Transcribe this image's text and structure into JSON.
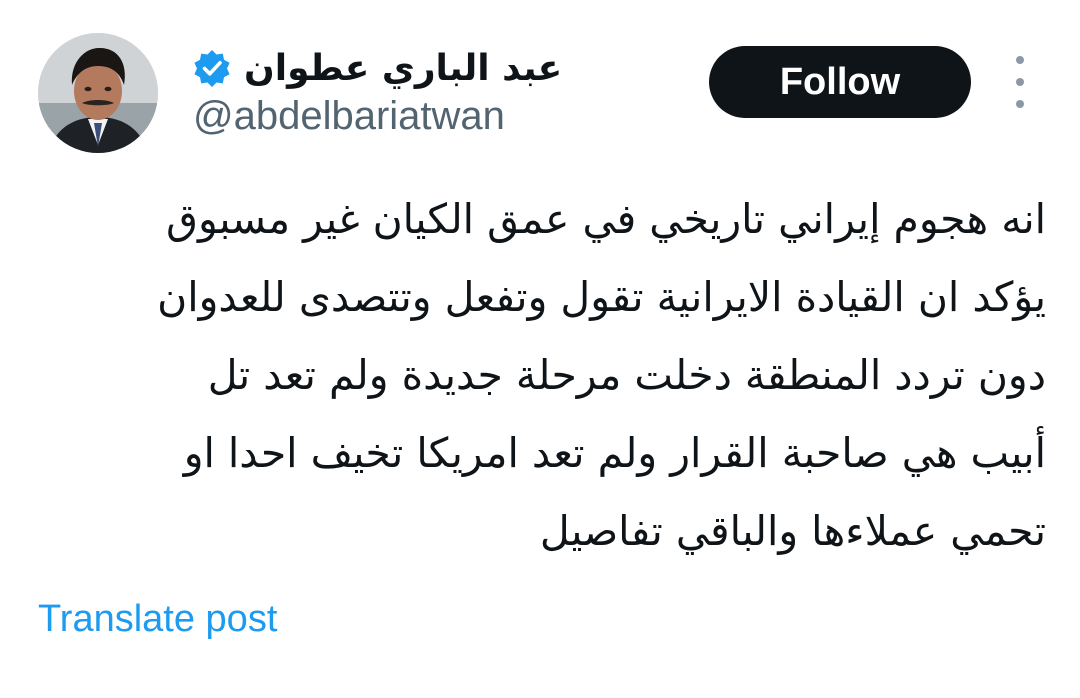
{
  "author": {
    "display_name": "عبد الباري عطوان",
    "handle": "@abdelbariatwan",
    "verified": true,
    "avatar_icon": "person-portrait",
    "verified_icon": "verified-badge-icon"
  },
  "actions": {
    "follow_label": "Follow",
    "more_icon": "more-vertical-icon"
  },
  "post": {
    "lines": [
      "انه هجوم إيراني تاريخي في عمق الكيان غير مسبوق",
      "يؤكد ان القيادة الايرانية تقول وتفعل وتتصدى للعدوان",
      "دون تردد المنطقة دخلت مرحلة جديدة ولم تعد تل",
      "أبيب هي صاحبة القرار ولم تعد امريكا تخيف احدا او",
      "تحمي عملاءها والباقي تفاصيل"
    ],
    "translate_label": "Translate post"
  },
  "colors": {
    "text": "#0f1419",
    "secondary": "#536471",
    "link": "#1d9bf0",
    "button_bg": "#0f1419",
    "verified": "#1d9bf0"
  }
}
